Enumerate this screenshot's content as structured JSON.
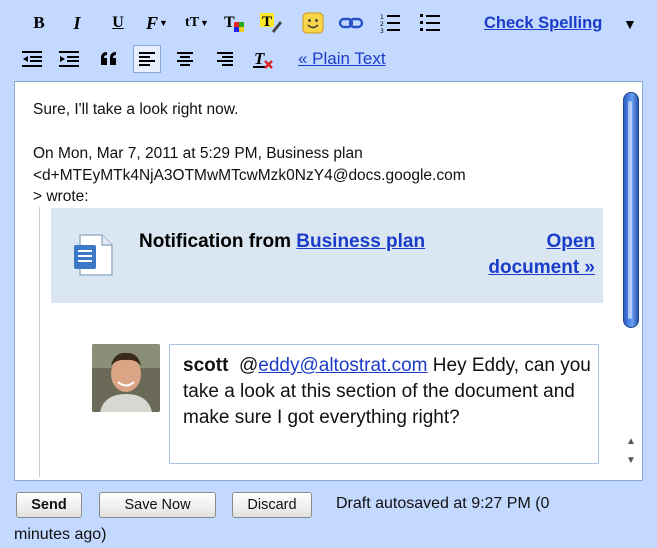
{
  "toolbar": {
    "row1": [
      {
        "name": "bold-button",
        "label": "B"
      },
      {
        "name": "italic-button",
        "label": "I"
      },
      {
        "name": "underline-button",
        "label": "U"
      },
      {
        "name": "font-button",
        "label": "F"
      },
      {
        "name": "font-size-button",
        "label": "tT"
      },
      {
        "name": "text-color-button"
      },
      {
        "name": "highlight-color-button"
      },
      {
        "name": "emoji-button"
      },
      {
        "name": "insert-link-button"
      },
      {
        "name": "numbered-list-button"
      },
      {
        "name": "bulleted-list-button"
      }
    ],
    "check_spelling": "Check Spelling",
    "check_spelling_caret": "▼",
    "plain_text": "« Plain Text"
  },
  "message": {
    "reply_line": "Sure, I'll take a look right now.",
    "quote_header_1": "On Mon, Mar 7, 2011 at 5:29 PM, Business plan",
    "quote_header_2": "<d+MTEyMTk4NjA3OTMwMTcwMzk0NzY4@docs.google.com",
    "quote_header_3": "> wrote:",
    "notification": {
      "prefix": "Notification from ",
      "doc_name": "Business plan",
      "open_link": "Open document »"
    },
    "comment": {
      "author": "scott",
      "mention": "@",
      "mention_email": "eddy@altostrat.com",
      "body": " Hey Eddy, can you take a look at this section of the document and make sure I got everything right?"
    }
  },
  "buttons": {
    "send": "Send",
    "save_now": "Save Now",
    "discard": "Discard"
  },
  "status": {
    "line1": "Draft autosaved at 9:27 PM (0",
    "line2": "minutes ago)"
  },
  "colors": {
    "toolbar_bg": "#c3d9ff",
    "link": "#1a3cc8",
    "notification_bg": "#dae7f3",
    "scrollbar": "#4f88e8"
  }
}
